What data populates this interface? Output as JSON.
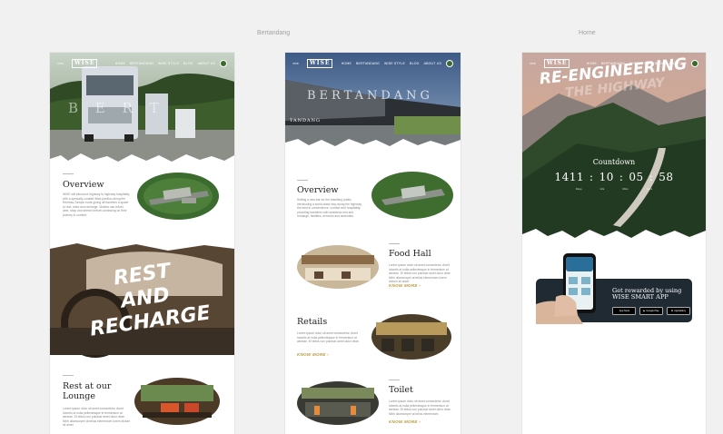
{
  "canvas_labels": {
    "left": "Bertandang",
    "right": "Home"
  },
  "nav": {
    "board1": [
      "HOME",
      "BERTANDANG",
      "WISE STYLE",
      "BLOG",
      "ABOUT US"
    ],
    "board2": [
      "HOME",
      "BERTANDANG",
      "WISE STYLE",
      "BLOG",
      "ABOUT US"
    ],
    "board3": [
      "HOME",
      "BERTANDANG",
      "WISE STYLE",
      "BLOG",
      "ABOUT US"
    ]
  },
  "logo": {
    "mark": "WISE",
    "prefix": "THE"
  },
  "board1": {
    "hero_word": "B E R T",
    "overview_title": "Overview",
    "overview_text": "WISE will introduce highway to highway hospitality with a specially-curated Wise pavilion along the Rembau-Tampin route giving all travelers a space to rest, relax and recharge. Visitors can refuel, dine, shop and stretch before continuing on their journey in comfort.",
    "rest_line1": "REST",
    "rest_line2": "AND",
    "rest_line3": "RECHARGE",
    "lounge_title": "Rest at our Lounge",
    "lounge_text": "Lorem ipsum dolor sit amet consectetur. Amet lobortis at nulla pellentesque in fermentum at aenean. Et tellus non pulvinar amet dolor vitae. Nibh ullamcorper at tellus elementum lorem dictum sit amet."
  },
  "board2": {
    "hero_word": "BERTANDANG",
    "hero_sign": "TANDANG",
    "overview_title": "Overview",
    "overview_text": "Setting a new bar for the travelling public, introducing a world-class stop along the highway, the best in convenience, comfort and hospitality, providing travellers with seamless rest and recharge, facilities, services and amenities.",
    "food_title": "Food Hall",
    "food_text": "Lorem ipsum dolor sit amet consectetur. Amet lobortis at nulla pellentesque in fermentum at aenean. Et tellus non pulvinar amet dolor vitae. Nibh ullamcorper at tellus elementum lorem dictum sit amet.",
    "retails_title": "Retails",
    "retails_text": "Lorem ipsum dolor sit amet consectetur. Amet lobortis at nulla pellentesque in fermentum at aenean. Et tellus non pulvinar amet dolor vitae.",
    "toilet_title": "Toilet",
    "toilet_text": "Lorem ipsum dolor sit amet consectetur. Amet lobortis at nulla pellentesque in fermentum at aenean. Et tellus non pulvinar amet dolor vitae. Nibh ullamcorper at tellus elementum.",
    "know_more": "KNOW MORE"
  },
  "board3": {
    "headline": "RE-ENGINEERING",
    "headline2": "THE HIGHWAY",
    "countdown_title": "Countdown",
    "days": "1411",
    "hours": "10",
    "minutes": "05",
    "seconds": "58",
    "sep": ":",
    "units": [
      "Days",
      "Hrs",
      "Mins",
      "Secs"
    ],
    "reward_line1": "Get rewarded by using",
    "reward_line2": "WISE SMART APP",
    "stores": [
      "App Store",
      "Google Play",
      "AppGallery"
    ]
  },
  "colors": {
    "accent_gold": "#b89a3a",
    "canvas": "#f1f1f1",
    "reward_card": "#1f2a32"
  }
}
